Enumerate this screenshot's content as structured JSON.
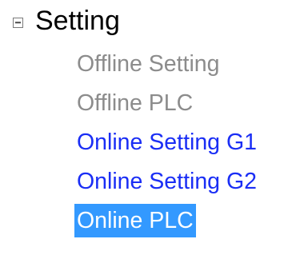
{
  "tree": {
    "root": {
      "label": "Setting",
      "expander_icon": "collapse-minus-icon",
      "expanded": true
    },
    "items": [
      {
        "label": "Offline Setting",
        "state": "disabled"
      },
      {
        "label": "Offline PLC",
        "state": "disabled"
      },
      {
        "label": "Online Setting G1",
        "state": "enabled"
      },
      {
        "label": "Online Setting G2",
        "state": "enabled"
      },
      {
        "label": "Online PLC",
        "state": "selected"
      }
    ]
  },
  "colors": {
    "disabled_text": "#8c8c8c",
    "link_text": "#1a2ef5",
    "selection_bg": "#3399ff",
    "selection_text": "#ffffff"
  }
}
